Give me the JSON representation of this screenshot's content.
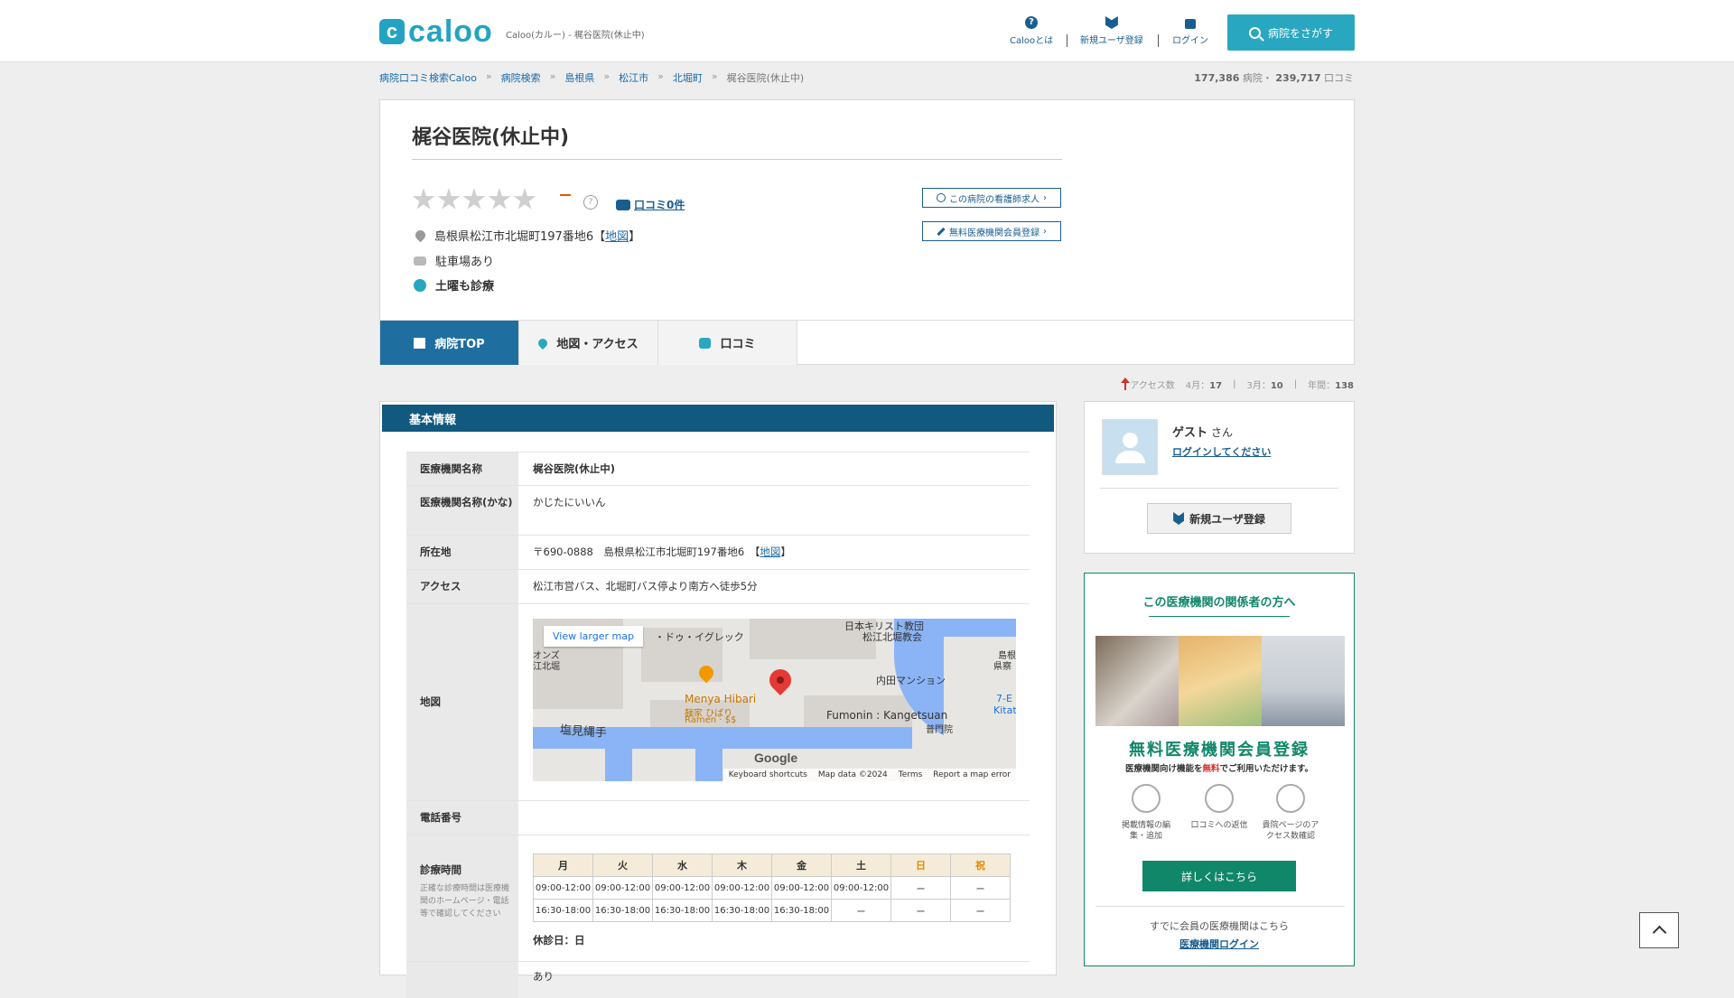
{
  "header": {
    "logo_mark": "c",
    "logo_text": "caloo",
    "caption": "Caloo(カルー) - 梶谷医院(休止中)",
    "nav": [
      {
        "label": "Calooとは",
        "icon": "question-icon"
      },
      {
        "label": "新規ユーザ登録",
        "icon": "beginner-leaf-icon"
      },
      {
        "label": "ログイン",
        "icon": "lock-icon"
      }
    ],
    "search_button": "病院をさがす"
  },
  "breadcrumb": [
    "病院口コミ検索Caloo",
    "病院検索",
    "島根県",
    "松江市",
    "北堀町",
    "梶谷医院(休止中)"
  ],
  "site_stats": {
    "hospitals_count": "177,386",
    "hospitals_unit": "病院・",
    "reviews_count": "239,717",
    "reviews_unit": "口コミ"
  },
  "hospital": {
    "name": "梶谷医院(休止中)",
    "rating": "–",
    "help": "?",
    "review_link": "口コミ0件",
    "address": "島根県松江市北堀町197番地6",
    "map_link": "地図",
    "parking": "駐車場あり",
    "saturday": "土曜も診療",
    "nurse_job_button": "この病院の看護師求人",
    "free_register_button": "無料医療機関会員登録"
  },
  "tabs": [
    {
      "label": "病院TOP",
      "icon": "hospital-icon"
    },
    {
      "label": "地図・アクセス",
      "icon": "map-pin-icon"
    },
    {
      "label": "口コミ",
      "icon": "speech-bubble-icon"
    }
  ],
  "access_stats": {
    "label": "アクセス数",
    "apr_label": "4月：",
    "apr": "17",
    "mar_label": "3月：",
    "mar": "10",
    "year_label": "年間：",
    "year": "138"
  },
  "basic_info": {
    "heading": "基本情報",
    "name_label": "医療機関名称",
    "name_value": "梶谷医院(休止中)",
    "kana_label": "医療機関名称(かな)",
    "kana_value": "かじたにいいん",
    "address_label": "所在地",
    "address_value": "〒690-0888　島根県松江市北堀町197番地6",
    "address_map": "地図",
    "access_label": "アクセス",
    "access_value": "松江市営バス、北堀町バス停より南方へ徒歩5分",
    "map_label": "地図",
    "phone_label": "電話番号",
    "hours_label": "診療時間",
    "hours_note": "正確な診療時間は医療機関のホームページ・電話等で確認してください",
    "closed_days": "休診日：日",
    "last_row_value": "あり"
  },
  "map": {
    "view_larger": "View larger map",
    "labels": [
      "日本キリスト教団",
      "松江北堀教会",
      "・ドゥ・イグレック",
      "内田マンション",
      "Menya Hibari",
      "麺家 ひばり",
      "Ramen · $$",
      "Fumonin : Kangetsuan",
      "普門院",
      "塩見縄手",
      "7-E",
      "Kitat",
      "島根",
      "県察",
      "オンズ",
      "江北堀"
    ],
    "brand": "Google",
    "footer": [
      "Keyboard shortcuts",
      "Map data ©2024",
      "Terms",
      "Report a map error"
    ]
  },
  "hours": {
    "days": [
      "月",
      "火",
      "水",
      "木",
      "金",
      "土",
      "日",
      "祝"
    ],
    "rows": [
      [
        "09:00-12:00",
        "09:00-12:00",
        "09:00-12:00",
        "09:00-12:00",
        "09:00-12:00",
        "09:00-12:00",
        "ー",
        "ー"
      ],
      [
        "16:30-18:00",
        "16:30-18:00",
        "16:30-18:00",
        "16:30-18:00",
        "16:30-18:00",
        "ー",
        "ー",
        "ー"
      ]
    ]
  },
  "user_card": {
    "name": "ゲスト",
    "honorific": "さん",
    "login_link": "ログインしてください",
    "register_button": "新規ユーザ登録"
  },
  "promo": {
    "title": "この医療機関の関係者の方へ",
    "big_title": "無料医療機関会員登録",
    "sub_prefix": "医療機関向け機能を",
    "sub_red": "無料",
    "sub_suffix": "でご利用いただけます。",
    "features": [
      "掲載情報の編集・追加",
      "口コミへの返信",
      "貴院ページのアクセス数確認"
    ],
    "detail_button": "詳しくはこちら",
    "member_note": "すでに会員の医療機関はこちら",
    "member_login": "医療機関ログイン"
  },
  "colors": {
    "brand": "#23a3c4",
    "nav_blue": "#1f6ea0",
    "section_head": "#11597f",
    "promo_green": "#11876a"
  }
}
